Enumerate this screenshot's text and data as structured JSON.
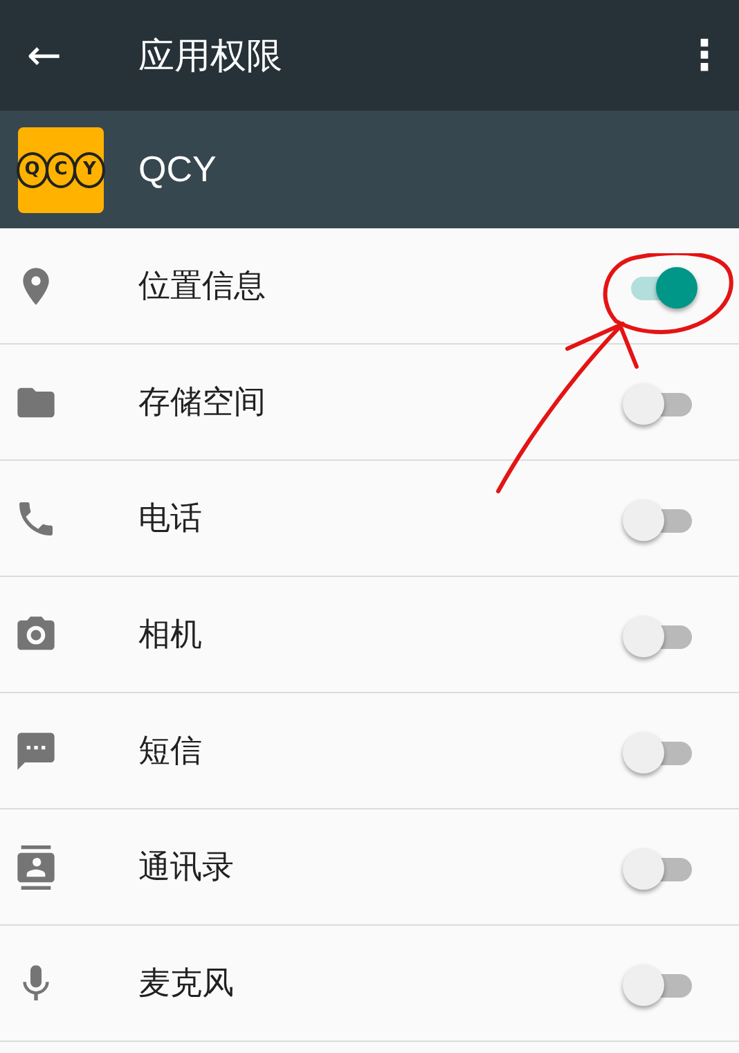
{
  "toolbar": {
    "back": "←",
    "title": "应用权限",
    "menu": "⋮"
  },
  "app": {
    "logo_letters": [
      "Q",
      "C",
      "Y"
    ],
    "name": "QCY"
  },
  "permissions": [
    {
      "label": "位置信息",
      "on": true
    },
    {
      "label": "存储空间",
      "on": false
    },
    {
      "label": "电话",
      "on": false
    },
    {
      "label": "相机",
      "on": false
    },
    {
      "label": "短信",
      "on": false
    },
    {
      "label": "通讯录",
      "on": false
    },
    {
      "label": "麦克风",
      "on": false
    }
  ]
}
